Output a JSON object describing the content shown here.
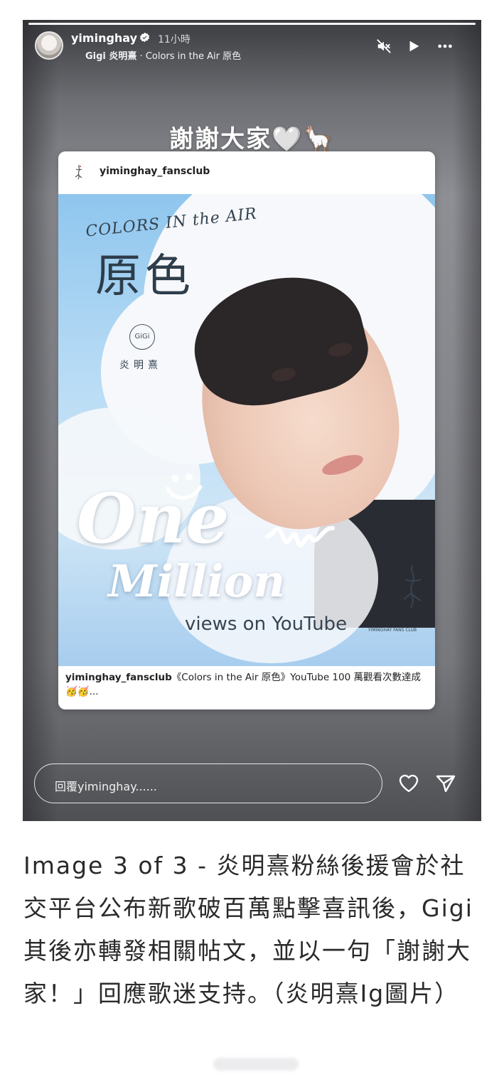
{
  "story": {
    "progress_fraction": 1.0,
    "header": {
      "username": "yiminghay",
      "time": "11小時",
      "music_artist": "Gigi 炎明熹",
      "music_sep": " · ",
      "music_title": "Colors in the Air 原色",
      "icons": [
        "mute-icon",
        "play-icon",
        "more-icon"
      ]
    },
    "caption": "謝謝大家🤍🦙",
    "shared_post": {
      "username": "yiminghay_fansclub",
      "poster": {
        "title_en": "COLORS IN the AIR",
        "title_cn": "原色",
        "badge": "GiGi",
        "artist": "炎明熹",
        "headline_one": "One",
        "headline_million": "Million",
        "headline_views": "views on YouTube",
        "fanclub_label": "YIMINGHAY FANS CLUB"
      },
      "caption_user": "yiminghay_fansclub",
      "caption_text": "《Colors in the Air 原色》YouTube 100 萬觀看次數達成 🥳🥳..."
    },
    "reply_placeholder": "回覆yiminghay......",
    "icons_footer": [
      "heart-icon",
      "send-icon"
    ]
  },
  "article_caption": "Image 3 of 3 - 炎明熹粉絲後援會於社交平台公布新歌破百萬點擊喜訊後，Gigi其後亦轉發相關帖文，並以一句「謝謝大家！」回應歌迷支持。（炎明熹Ig圖片）"
}
